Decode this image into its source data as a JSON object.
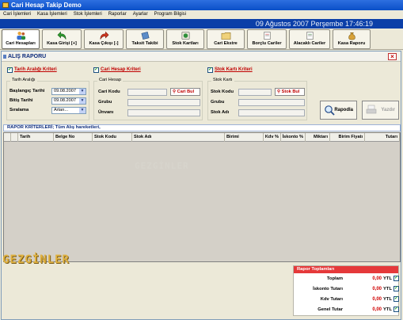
{
  "window": {
    "title": "Cari Hesap Takip Demo"
  },
  "menu": [
    "Cari İşlemleri",
    "Kasa İşlemleri",
    "Stok İşlemleri",
    "Raporlar",
    "Ayarlar",
    "Program Bilgisi"
  ],
  "date_text": "09 Ağustos 2007 Perşembe 17:46:19",
  "toolbar": [
    {
      "label": "Cari Hesapları",
      "icon": "users-icon"
    },
    {
      "label": "Kasa Girişi [+]",
      "icon": "green-arrow-icon"
    },
    {
      "label": "Kasa Çıkışı [-]",
      "icon": "red-arrow-icon"
    },
    {
      "label": "Taksit Takibi",
      "icon": "notebook-icon"
    },
    {
      "label": "Stok Kartları",
      "icon": "box-icon"
    },
    {
      "label": "Cari Ekstre",
      "icon": "folder-icon"
    },
    {
      "label": "Borçlu Cariler",
      "icon": "document-icon"
    },
    {
      "label": "Alacaklı Cariler",
      "icon": "document-icon"
    },
    {
      "label": "Kasa Raporu",
      "icon": "money-bag-icon"
    }
  ],
  "panel": {
    "title": "ALIŞ RAPORU",
    "criteria": {
      "date": "Tarih Aralığı Kriteri",
      "account": "Cari Hesap Kriteri",
      "stock": "Stok Kartı Kriteri"
    },
    "date_group": {
      "legend": "Tarih Aralığı",
      "start_label": "Başlangıç Tarihi",
      "start_value": "09.08.2007",
      "end_label": "Bitiş Tarihi",
      "end_value": "09.08.2007",
      "sort_label": "Sıralama",
      "sort_value": "Artan..."
    },
    "account_group": {
      "legend": "Cari Hesap",
      "code_label": "Cari Kodu",
      "find_label": "Cari Bul",
      "group_label": "Grubu",
      "title_label": "Ünvanı"
    },
    "stock_group": {
      "legend": "Stok Kartı",
      "code_label": "Stok Kodu",
      "find_label": "Stok Bul",
      "group_label": "Grubu",
      "name_label": "Stok Adı"
    },
    "report_button": "Rapodla",
    "print_button": "Yazdır",
    "criteria_bar": "RAPOR KRİTERLERİ; Tüm Alış hareketleri,",
    "columns": [
      "Tarih",
      "Belge No",
      "Stok Kodu",
      "Stok Adı",
      "Birimi",
      "Kdv %",
      "İskonto %",
      "Miktarı",
      "Birim Fiyatı",
      "Tutarı"
    ],
    "watermark": "GEZGİNLER",
    "totals": {
      "header": "Rapor Toplamları",
      "rows": [
        {
          "label": "Toplam",
          "value": "0,00",
          "currency": "YTL"
        },
        {
          "label": "İskonto Tutarı",
          "value": "0,00",
          "currency": "YTL"
        },
        {
          "label": "Kdv Tutarı",
          "value": "0,00",
          "currency": "YTL"
        },
        {
          "label": "Genel Tutar",
          "value": "0,00",
          "currency": "YTL"
        }
      ]
    }
  },
  "bottom_watermark": "GEZGİNLER",
  "colors": {
    "accent": "#0b3fa8",
    "danger": "#c00000",
    "check": "#21a121"
  }
}
